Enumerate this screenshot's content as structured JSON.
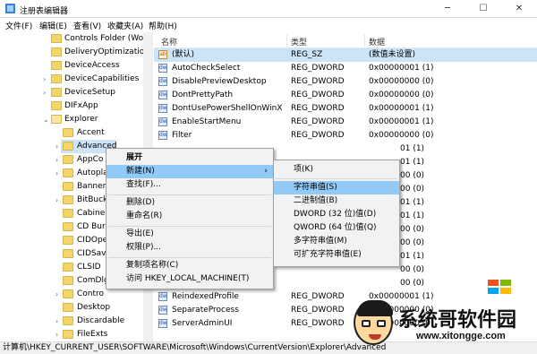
{
  "window": {
    "title": "注册表编辑器",
    "min_glyph": "─",
    "max_glyph": "☐",
    "close_glyph": "✕"
  },
  "menubar": [
    "文件(F)",
    "编辑(E)",
    "查看(V)",
    "收藏夹(A)",
    "帮助(H)"
  ],
  "tree": [
    {
      "label": "Controls Folder (Wo",
      "expander": ""
    },
    {
      "label": "DeliveryOptimization",
      "expander": ""
    },
    {
      "label": "DeviceAccess",
      "expander": ""
    },
    {
      "label": "DeviceCapabilities",
      "expander": "›"
    },
    {
      "label": "DeviceSetup",
      "expander": "›"
    },
    {
      "label": "DIFxApp",
      "expander": ""
    },
    {
      "label": "Explorer",
      "expander": "⌄"
    },
    {
      "label": "Accent",
      "expander": ""
    },
    {
      "label": "Advanced",
      "expander": "›"
    },
    {
      "label": "AppCo",
      "expander": "›"
    },
    {
      "label": "Autopla",
      "expander": "›"
    },
    {
      "label": "Banner",
      "expander": ""
    },
    {
      "label": "BitBuck",
      "expander": "›"
    },
    {
      "label": "Cabine",
      "expander": ""
    },
    {
      "label": "CD Bur",
      "expander": ""
    },
    {
      "label": "CIDOpe",
      "expander": ""
    },
    {
      "label": "CIDSav",
      "expander": ""
    },
    {
      "label": "CLSID",
      "expander": ""
    },
    {
      "label": "ComDlg",
      "expander": ""
    },
    {
      "label": "Contro",
      "expander": "›"
    },
    {
      "label": "Desktop",
      "expander": ""
    },
    {
      "label": "Discardable",
      "expander": "›"
    },
    {
      "label": "FileExts",
      "expander": "›"
    }
  ],
  "columns": {
    "name": "名称",
    "type": "类型",
    "data": "数据"
  },
  "rows": [
    {
      "name": "(默认)",
      "type": "REG_SZ",
      "data": "(数值未设置)",
      "icon": "ab"
    },
    {
      "name": "AutoCheckSelect",
      "type": "REG_DWORD",
      "data": "0x00000001 (1)",
      "icon": "dw"
    },
    {
      "name": "DisablePreviewDesktop",
      "type": "REG_DWORD",
      "data": "0x00000000 (0)",
      "icon": "dw"
    },
    {
      "name": "DontPrettyPath",
      "type": "REG_DWORD",
      "data": "0x00000000 (0)",
      "icon": "dw"
    },
    {
      "name": "DontUsePowerShellOnWinX",
      "type": "REG_DWORD",
      "data": "0x00000001 (1)",
      "icon": "dw"
    },
    {
      "name": "EnableStartMenu",
      "type": "REG_DWORD",
      "data": "0x00000001 (1)",
      "icon": "dw"
    },
    {
      "name": "Filter",
      "type": "REG_DWORD",
      "data": "0x00000000 (0)",
      "icon": "dw"
    },
    {
      "name": "",
      "type": "",
      "data": "01 (1)",
      "icon": ""
    },
    {
      "name": "",
      "type": "",
      "data": "01 (1)",
      "icon": ""
    },
    {
      "name": "",
      "type": "",
      "data": "00 (0)",
      "icon": ""
    },
    {
      "name": "",
      "type": "",
      "data": "00 (0)",
      "icon": ""
    },
    {
      "name": "",
      "type": "",
      "data": "01 (1)",
      "icon": ""
    },
    {
      "name": "",
      "type": "",
      "data": "01 (1)",
      "icon": ""
    },
    {
      "name": "",
      "type": "",
      "data": "00 (0)",
      "icon": ""
    },
    {
      "name": "",
      "type": "",
      "data": "00 (0)",
      "icon": ""
    },
    {
      "name": "",
      "type": "",
      "data": "01 (1)",
      "icon": ""
    },
    {
      "name": "",
      "type": "",
      "data": "00 (0)",
      "icon": ""
    },
    {
      "name": "",
      "type": "",
      "data": "00 (0)",
      "icon": ""
    },
    {
      "name": "ReindexedProfile",
      "type": "REG_DWORD",
      "data": "0x00000001 (1)",
      "icon": "dw"
    },
    {
      "name": "SeparateProcess",
      "type": "REG_DWORD",
      "data": "0x00000000 (0)",
      "icon": "dw"
    },
    {
      "name": "ServerAdminUI",
      "type": "REG_DWORD",
      "data": "0x00000000 (0)",
      "icon": "dw"
    }
  ],
  "context_menu": {
    "items": [
      "展开",
      "新建(N)",
      "查找(F)...",
      "删除(D)",
      "重命名(R)",
      "导出(E)",
      "权限(P)...",
      "复制项名称(C)",
      "访问 HKEY_LOCAL_MACHINE(T)"
    ],
    "submenu_arrow": "›"
  },
  "submenu": {
    "items": [
      "项(K)",
      "字符串值(S)",
      "二进制值(B)",
      "DWORD (32 位)值(D)",
      "QWORD (64 位)值(Q)",
      "多字符串值(M)",
      "可扩充字符串值(E)"
    ]
  },
  "statusbar": "计算机\\HKEY_CURRENT_USER\\SOFTWARE\\Microsoft\\Windows\\CurrentVersion\\Explorer\\Advanced",
  "watermark": {
    "brand": "系统哥软件园",
    "url": "www.xitongge.com"
  },
  "colors": {
    "selection": "#cce4f7",
    "menu_hover": "#91c9f7",
    "folder": "#f3d66a"
  }
}
